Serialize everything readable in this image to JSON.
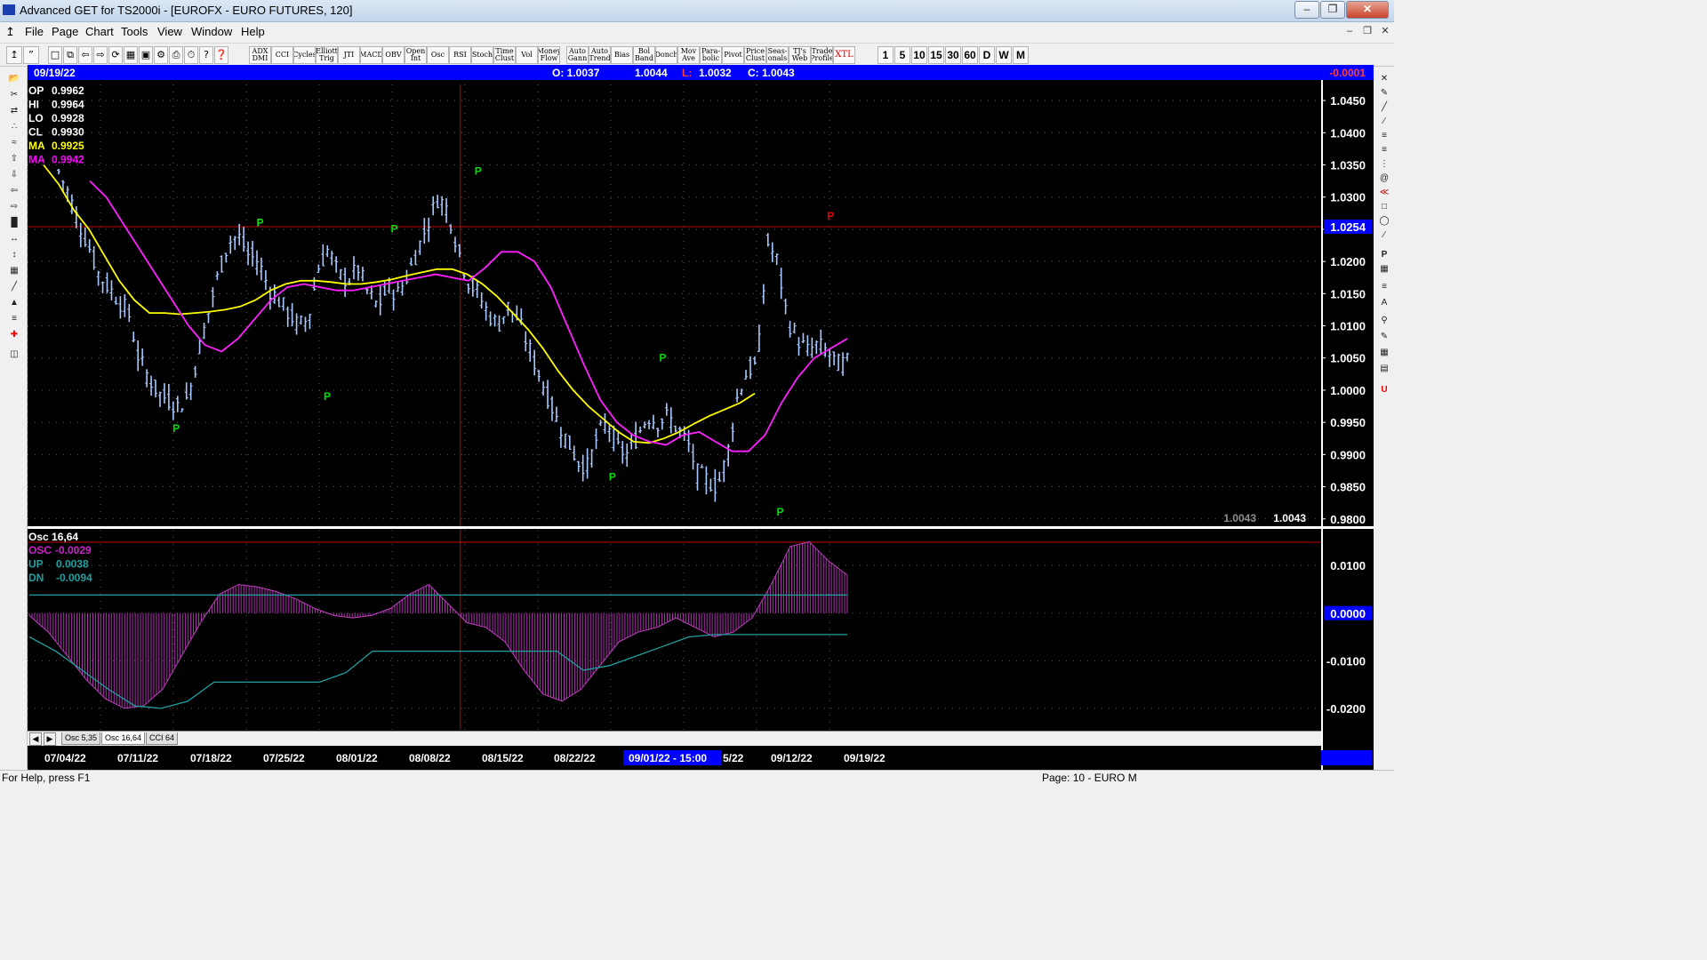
{
  "window": {
    "title": "Advanced GET for TS2000i - [EUROFX - EURO FUTURES, 120]"
  },
  "menu": [
    "File",
    "Page",
    "Chart",
    "Tools",
    "View",
    "Window",
    "Help"
  ],
  "toolbar": {
    "indicators": [
      "ADX\nDMI",
      "CCI",
      "Cycles",
      "Elliott\nTrig",
      "JTI",
      "MACD",
      "OBV",
      "Open\nInt",
      "Osc",
      "RSI",
      "Stoch",
      "Time\nClust",
      "Vol",
      "Money\nFlow",
      "Auto\nGann",
      "Auto\nTrend",
      "Bias",
      "Bol\nBand",
      "Donch",
      "Mov\nAve",
      "Para-\nbolic",
      "Pivot",
      "Price\nClust",
      "Seas-\nonals",
      "TJ's\nWeb",
      "Trade\nProfile",
      "XTL"
    ],
    "bar_intervals": [
      "1",
      "5",
      "10",
      "15",
      "30",
      "60",
      "D",
      "W",
      "M"
    ]
  },
  "header": {
    "date": "09/19/22",
    "open": "O: 1.0037",
    "high": "1.0044",
    "low": "L: 1.0032",
    "close": "C: 1.0043",
    "change": "-0.0001"
  },
  "price_panel": {
    "readout": [
      {
        "label": "OP",
        "value": "0.9962",
        "color": "#ffffff"
      },
      {
        "label": "HI",
        "value": "0.9964",
        "color": "#ffffff"
      },
      {
        "label": "LO",
        "value": "0.9928",
        "color": "#ffffff"
      },
      {
        "label": "CL",
        "value": "0.9930",
        "color": "#ffffff"
      },
      {
        "label": "MA",
        "value": "0.9925",
        "color": "#ffff00"
      },
      {
        "label": "MA",
        "value": "0.9942",
        "color": "#ff00ff"
      }
    ],
    "last_price_left": "1.0043",
    "last_price_right": "1.0043",
    "highlight_price": "1.0254",
    "pivot_marker": "P"
  },
  "osc_panel": {
    "title": "Osc 16,64",
    "readout": [
      {
        "label": "OSC",
        "value": "-0.0029",
        "color": "#d020d0"
      },
      {
        "label": "UP",
        "value": "0.0038",
        "color": "#20a0a0"
      },
      {
        "label": "DN",
        "value": "-0.0094",
        "color": "#20a0a0"
      }
    ],
    "zero_label": "0.0000"
  },
  "tabs": [
    "Osc 5,35",
    "Osc 16,64",
    "CCI 64"
  ],
  "active_tab": 1,
  "x_axis": {
    "labels": [
      "07/04/22",
      "07/11/22",
      "07/18/22",
      "07/25/22",
      "08/01/22",
      "08/08/22",
      "08/15/22",
      "08/22/22",
      "5/22",
      "09/12/22",
      "09/19/22"
    ],
    "cursor_label": "09/01/22 - 15:00"
  },
  "status": {
    "help": "For Help, press F1",
    "page": "Page: 10 - EURO M"
  },
  "chart_data": {
    "type": "bar",
    "title": "EUROFX - EURO FUTURES, 120",
    "price_ticks": [
      "1.0450",
      "1.0400",
      "1.0350",
      "1.0300",
      "1.0250",
      "1.0200",
      "1.0150",
      "1.0100",
      "1.0050",
      "1.0000",
      "0.9950",
      "0.9900",
      "0.9850",
      "0.9800"
    ],
    "price_ylim": [
      0.979,
      1.0475
    ],
    "osc_ticks": [
      "0.0100",
      "0.0000",
      "-0.0100",
      "-0.0200"
    ],
    "osc_ylim": [
      -0.0245,
      0.0175
    ],
    "price_closes": [
      1.034,
      1.0305,
      1.026,
      1.0225,
      1.018,
      1.016,
      1.014,
      1.012,
      1.005,
      1.002,
      0.9995,
      0.9985,
      0.9975,
      0.999,
      1.006,
      1.012,
      1.018,
      1.023,
      1.024,
      1.021,
      1.02,
      1.016,
      1.014,
      1.012,
      1.01,
      1.011,
      1.019,
      1.022,
      1.018,
      1.017,
      1.019,
      1.015,
      1.013,
      1.016,
      1.015,
      1.018,
      1.022,
      1.026,
      1.03,
      1.028,
      1.022,
      1.017,
      1.015,
      1.012,
      1.01,
      1.013,
      1.011,
      1.007,
      1.003,
      0.999,
      0.995,
      0.992,
      0.989,
      0.988,
      0.993,
      0.995,
      0.991,
      0.99,
      0.993,
      0.996,
      0.995,
      0.996,
      0.994,
      0.992,
      0.987,
      0.986,
      0.985,
      0.99,
      0.999,
      1.003,
      1.004,
      1.023,
      1.02,
      1.011,
      1.008,
      1.006,
      1.007,
      1.006,
      1.004,
      1.0043
    ],
    "ma_yellow": [
      1.035,
      1.032,
      1.028,
      1.025,
      1.021,
      1.017,
      1.014,
      1.012,
      1.012,
      1.0118,
      1.012,
      1.0122,
      1.0125,
      1.013,
      1.014,
      1.0155,
      1.0165,
      1.017,
      1.017,
      1.0168,
      1.0165,
      1.0165,
      1.0168,
      1.0172,
      1.0178,
      1.0183,
      1.0188,
      1.0188,
      1.018,
      1.0165,
      1.0145,
      1.012,
      1.0095,
      1.0065,
      1.003,
      1.0,
      0.9975,
      0.9955,
      0.9935,
      0.992,
      0.9918,
      0.9925,
      0.9935,
      0.9948,
      0.996,
      0.997,
      0.998,
      0.9995
    ],
    "ma_magenta": [
      1.0325,
      1.03,
      1.026,
      1.022,
      1.018,
      1.014,
      1.01,
      1.007,
      1.006,
      1.008,
      1.011,
      1.014,
      1.016,
      1.0165,
      1.016,
      1.0155,
      1.0155,
      1.016,
      1.0165,
      1.017,
      1.0175,
      1.018,
      1.0175,
      1.017,
      1.019,
      1.0215,
      1.0215,
      1.02,
      1.016,
      1.01,
      1.004,
      0.9985,
      0.995,
      0.993,
      0.992,
      0.9915,
      0.993,
      0.9935,
      0.992,
      0.9905,
      0.9905,
      0.993,
      0.998,
      1.002,
      1.005,
      1.0065,
      1.008
    ],
    "pivots": [
      {
        "label": "P",
        "index": 7,
        "price": 0.9935,
        "color": "#00e000"
      },
      {
        "label": "P",
        "index": 12,
        "price": 1.0255,
        "color": "#00e000"
      },
      {
        "label": "P",
        "index": 16,
        "price": 0.9985,
        "color": "#00e000"
      },
      {
        "label": "P",
        "index": 20,
        "price": 1.0245,
        "color": "#00e000"
      },
      {
        "label": "P",
        "index": 25,
        "price": 1.0335,
        "color": "#00e000"
      },
      {
        "label": "P",
        "index": 33,
        "price": 0.986,
        "color": "#00e000"
      },
      {
        "label": "P",
        "index": 36,
        "price": 1.0045,
        "color": "#00e000"
      },
      {
        "label": "P",
        "index": 43,
        "price": 0.9805,
        "color": "#00e000"
      },
      {
        "label": "P",
        "index": 46,
        "price": 1.0265,
        "color": "#e00000"
      }
    ],
    "osc_values": [
      -0.0005,
      -0.004,
      -0.009,
      -0.014,
      -0.018,
      -0.02,
      -0.0195,
      -0.016,
      -0.009,
      -0.002,
      0.004,
      0.006,
      0.0055,
      0.0045,
      0.003,
      0.001,
      -0.0005,
      -0.001,
      -0.0005,
      0.001,
      0.004,
      0.006,
      0.002,
      -0.002,
      -0.003,
      -0.006,
      -0.012,
      -0.017,
      -0.0185,
      -0.016,
      -0.011,
      -0.006,
      -0.004,
      -0.003,
      -0.001,
      -0.003,
      -0.005,
      -0.004,
      -0.001,
      0.006,
      0.014,
      0.015,
      0.011,
      0.008
    ],
    "osc_up": [
      0.0038,
      0.0038,
      0.0038,
      0.0038,
      0.0038,
      0.0038,
      0.0038,
      0.0038,
      0.0038,
      0.0038,
      0.0038,
      0.0038
    ],
    "osc_dn": [
      -0.005,
      -0.008,
      -0.012,
      -0.016,
      -0.0195,
      -0.02,
      -0.0185,
      -0.0145,
      -0.0145,
      -0.0145,
      -0.0145,
      -0.0145,
      -0.0125,
      -0.008,
      -0.008,
      -0.008,
      -0.008,
      -0.008,
      -0.008,
      -0.008,
      -0.008,
      -0.012,
      -0.011,
      -0.009,
      -0.007,
      -0.005,
      -0.0045,
      -0.0045,
      -0.0045,
      -0.0045,
      -0.0045,
      -0.0045
    ],
    "cursor_index": 0.49,
    "highlight_level": 1.0254,
    "grid": true
  }
}
